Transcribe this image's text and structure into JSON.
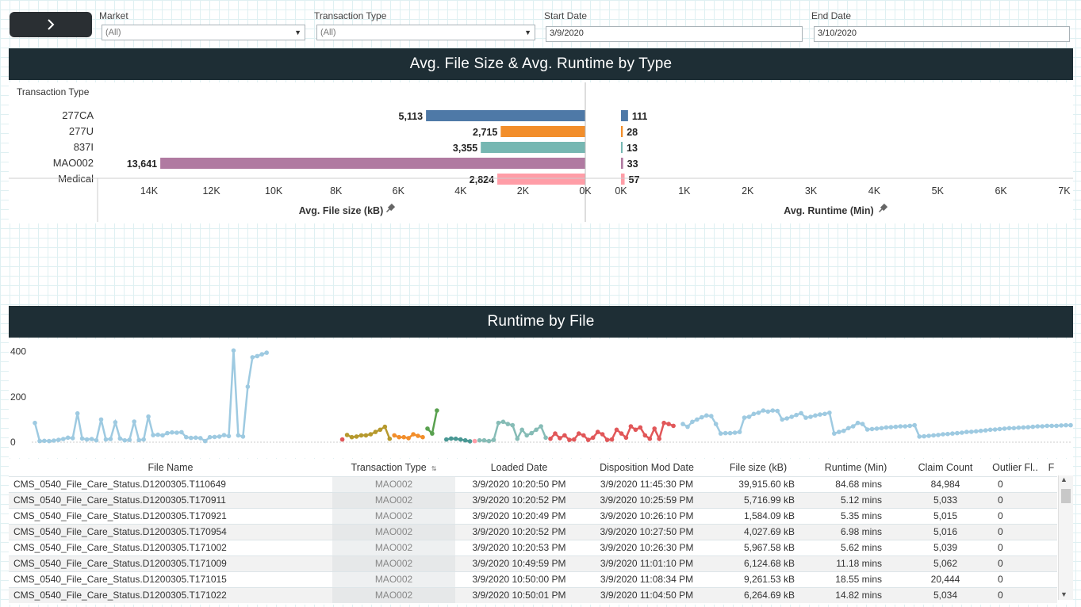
{
  "filters": {
    "market": {
      "label": "Market",
      "value": "(All)"
    },
    "transaction_type": {
      "label": "Transaction Type",
      "value": "(All)"
    },
    "start_date": {
      "label": "Start Date",
      "value": "3/9/2020"
    },
    "end_date": {
      "label": "End Date",
      "value": "3/10/2020"
    }
  },
  "icons": {
    "expand": "chevron-right-icon",
    "dropdown": "caret-down-icon",
    "pin": "pin-icon",
    "sort": "sort-icon",
    "scroll_down": "chevron-down-icon"
  },
  "bar_section": {
    "title": "Avg. File Size & Avg. Runtime by Type",
    "row_header": "Transaction Type"
  },
  "line_section": {
    "title": "Runtime by File"
  },
  "chart_data": [
    {
      "type": "bar",
      "orientation": "horizontal-reversed",
      "categories": [
        "277CA",
        "277U",
        "837I",
        "MAO002",
        "Medical"
      ],
      "values": [
        5113,
        2715,
        3355,
        13641,
        2824
      ],
      "value_labels": [
        "5,113",
        "2,715",
        "3,355",
        "13,641",
        "2,824"
      ],
      "colors": [
        "#4e79a7",
        "#f28e2b",
        "#76b7b2",
        "#b07aa1",
        "#ff9da7"
      ],
      "xlabel": "Avg. File size (kB)",
      "xlim": [
        0,
        14500
      ],
      "ticks": [
        14000,
        12000,
        10000,
        8000,
        6000,
        4000,
        2000,
        0
      ],
      "tick_labels": [
        "14K",
        "12K",
        "10K",
        "8K",
        "6K",
        "4K",
        "2K",
        "0K"
      ]
    },
    {
      "type": "bar",
      "orientation": "horizontal",
      "categories": [
        "277CA",
        "277U",
        "837I",
        "MAO002",
        "Medical"
      ],
      "values": [
        111,
        28,
        13,
        33,
        57
      ],
      "value_labels": [
        "111",
        "28",
        "13",
        "33",
        "57"
      ],
      "colors": [
        "#4e79a7",
        "#f28e2b",
        "#76b7b2",
        "#b07aa1",
        "#ff9da7"
      ],
      "xlabel": "Avg. Runtime (Min)",
      "xlim": [
        0,
        7000
      ],
      "ticks": [
        0,
        1000,
        2000,
        3000,
        4000,
        5000,
        6000,
        7000
      ],
      "tick_labels": [
        "0K",
        "1K",
        "2K",
        "3K",
        "4K",
        "5K",
        "6K",
        "7K"
      ]
    },
    {
      "type": "line",
      "ylim": [
        0,
        420
      ],
      "yticks": [
        0,
        200,
        400
      ],
      "ytick_labels": [
        "0",
        "200",
        "400"
      ],
      "x_count": 220,
      "series": [
        {
          "color": "#9ecae1",
          "x": [
            0,
            1,
            2,
            3,
            4,
            5,
            6,
            7,
            8,
            9,
            10,
            11,
            12,
            13,
            14,
            15,
            16,
            17,
            18,
            19,
            20,
            21,
            22,
            23,
            24,
            25,
            26,
            27,
            28,
            29,
            30,
            31,
            32,
            33,
            34,
            35,
            36,
            37,
            38,
            39,
            40,
            41,
            42,
            43,
            44,
            45,
            46,
            47,
            48,
            49,
            50,
            51,
            52,
            53,
            54,
            55,
            56,
            57,
            58,
            59,
            60
          ],
          "y": [
            85,
            5,
            6,
            5,
            7,
            10,
            14,
            20,
            18,
            127,
            16,
            12,
            14,
            8,
            100,
            12,
            14,
            88,
            16,
            8,
            10,
            91,
            9,
            12,
            113,
            31,
            33,
            30,
            40,
            43,
            42,
            44,
            22,
            19,
            20,
            18,
            5,
            22,
            23,
            25,
            31,
            27,
            405,
            30,
            25,
            245,
            375,
            380,
            388,
            395,
            null,
            null,
            null,
            null,
            null,
            null,
            null,
            null,
            null,
            null,
            null
          ]
        },
        {
          "color": "#e15759",
          "x": [
            65
          ],
          "y": [
            12
          ]
        },
        {
          "color": "#b6992d",
          "x": [
            66,
            67,
            68,
            69,
            70,
            71,
            72,
            73,
            74,
            75
          ],
          "y": [
            32,
            22,
            25,
            30,
            30,
            35,
            45,
            55,
            68,
            15
          ]
        },
        {
          "color": "#f28e2b",
          "x": [
            76,
            77,
            78,
            79,
            80,
            81,
            82
          ],
          "y": [
            30,
            22,
            22,
            18,
            35,
            28,
            22
          ]
        },
        {
          "color": "#59a14f",
          "x": [
            83,
            84,
            85
          ],
          "y": [
            60,
            38,
            140
          ]
        },
        {
          "color": "#499894",
          "x": [
            87,
            88,
            89,
            90,
            91,
            92
          ],
          "y": [
            12,
            16,
            15,
            12,
            8,
            4
          ]
        },
        {
          "color": "#ff9da7",
          "x": [
            93
          ],
          "y": [
            5
          ]
        },
        {
          "color": "#86bcb6",
          "x": [
            94,
            95,
            96,
            97,
            98,
            99,
            100,
            101,
            102,
            103,
            104,
            105,
            106,
            107,
            108
          ],
          "y": [
            8,
            8,
            5,
            10,
            85,
            90,
            80,
            75,
            15,
            55,
            30,
            40,
            55,
            70,
            20
          ]
        },
        {
          "color": "#e15759",
          "x": [
            109,
            110,
            111,
            112,
            113,
            114,
            115,
            116,
            117,
            118,
            119,
            120,
            121,
            122,
            123,
            124,
            125,
            126,
            127,
            128,
            129,
            130,
            131,
            132,
            133,
            134,
            135
          ],
          "y": [
            15,
            38,
            18,
            30,
            10,
            12,
            38,
            30,
            10,
            20,
            45,
            35,
            10,
            12,
            55,
            38,
            20,
            70,
            55,
            65,
            30,
            15,
            60,
            15,
            85,
            80,
            72
          ]
        },
        {
          "color": "#9ecae1",
          "x": [
            137,
            138,
            139,
            140,
            141,
            142,
            143,
            144,
            145,
            146,
            147,
            148,
            149,
            150,
            151,
            152,
            153,
            154,
            155,
            156,
            157,
            158,
            159,
            160,
            161,
            162,
            163,
            164,
            165,
            166,
            167,
            168,
            169,
            170,
            171,
            172,
            173,
            174,
            175,
            176,
            177,
            178,
            179,
            180,
            181,
            182,
            183,
            184,
            185,
            186,
            187,
            188,
            189,
            190,
            191,
            192,
            193,
            194,
            195,
            196,
            197,
            198,
            199,
            200,
            201,
            202,
            203,
            204,
            205,
            206,
            207,
            208,
            209,
            210,
            211,
            212,
            213,
            214,
            215,
            216,
            217,
            218,
            219
          ],
          "y": [
            80,
            68,
            90,
            100,
            110,
            118,
            115,
            80,
            38,
            40,
            40,
            42,
            45,
            108,
            112,
            125,
            130,
            140,
            135,
            140,
            138,
            100,
            105,
            112,
            120,
            128,
            108,
            112,
            118,
            122,
            125,
            130,
            38,
            45,
            50,
            62,
            70,
            85,
            80,
            56,
            58,
            60,
            62,
            65,
            66,
            68,
            70,
            70,
            72,
            75,
            25,
            26,
            28,
            30,
            32,
            35,
            36,
            38,
            40,
            42,
            45,
            46,
            48,
            50,
            52,
            55,
            56,
            58,
            60,
            62,
            62,
            64,
            65,
            66,
            68,
            70,
            70,
            72,
            72,
            72,
            74,
            75,
            75
          ]
        }
      ]
    }
  ],
  "table": {
    "columns": [
      "File Name",
      "Transaction Type",
      "Loaded Date",
      "Disposition Mod Date",
      "File size (kB)",
      "Runtime (Min)",
      "Claim Count",
      "Outlier Fl..",
      "F"
    ],
    "rows": [
      [
        "CMS_0540_File_Care_Status.D1200305.T110649",
        "MAO002",
        "3/9/2020 10:20:50 PM",
        "3/9/2020 11:45:30 PM",
        "39,915.60 kB",
        "84.68 mins",
        "84,984",
        "0"
      ],
      [
        "CMS_0540_File_Care_Status.D1200305.T170911",
        "MAO002",
        "3/9/2020 10:20:52 PM",
        "3/9/2020 10:25:59 PM",
        "5,716.99 kB",
        "5.12 mins",
        "5,033",
        "0"
      ],
      [
        "CMS_0540_File_Care_Status.D1200305.T170921",
        "MAO002",
        "3/9/2020 10:20:49 PM",
        "3/9/2020 10:26:10 PM",
        "1,584.09 kB",
        "5.35 mins",
        "5,015",
        "0"
      ],
      [
        "CMS_0540_File_Care_Status.D1200305.T170954",
        "MAO002",
        "3/9/2020 10:20:52 PM",
        "3/9/2020 10:27:50 PM",
        "4,027.69 kB",
        "6.98 mins",
        "5,016",
        "0"
      ],
      [
        "CMS_0540_File_Care_Status.D1200305.T171002",
        "MAO002",
        "3/9/2020 10:20:53 PM",
        "3/9/2020 10:26:30 PM",
        "5,967.58 kB",
        "5.62 mins",
        "5,039",
        "0"
      ],
      [
        "CMS_0540_File_Care_Status.D1200305.T171009",
        "MAO002",
        "3/9/2020 10:49:59 PM",
        "3/9/2020 11:01:10 PM",
        "6,124.68 kB",
        "11.18 mins",
        "5,062",
        "0"
      ],
      [
        "CMS_0540_File_Care_Status.D1200305.T171015",
        "MAO002",
        "3/9/2020 10:50:00 PM",
        "3/9/2020 11:08:34 PM",
        "9,261.53 kB",
        "18.55 mins",
        "20,444",
        "0"
      ],
      [
        "CMS_0540_File_Care_Status.D1200305.T171022",
        "MAO002",
        "3/9/2020 10:50:01 PM",
        "3/9/2020 11:04:50 PM",
        "6,264.69 kB",
        "14.82 mins",
        "5,034",
        "0"
      ]
    ]
  }
}
